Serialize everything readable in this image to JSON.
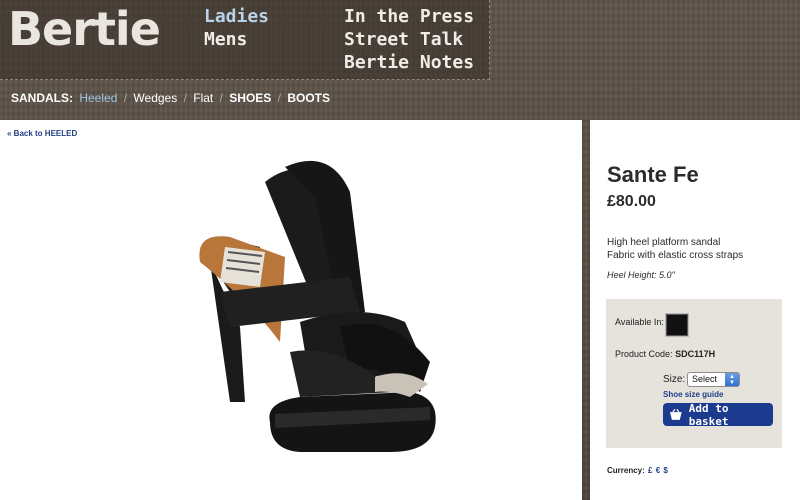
{
  "brand": {
    "logo": "Bertie"
  },
  "nav": {
    "col1": [
      {
        "label": "Ladies",
        "active": true
      },
      {
        "label": "Mens",
        "active": false
      }
    ],
    "col2": [
      {
        "label": "In the Press"
      },
      {
        "label": "Street Talk"
      },
      {
        "label": "Bertie Notes"
      }
    ]
  },
  "subnav": {
    "sandals_label": "SANDALS:",
    "heeled": "Heeled",
    "wedges": "Wedges",
    "flat": "Flat",
    "shoes": "SHOES",
    "boots": "BOOTS",
    "separator": "/"
  },
  "main": {
    "back_link": "« Back to HEELED"
  },
  "product": {
    "name": "Sante Fe",
    "price": "£80.00",
    "description_line1": "High heel platform sandal",
    "description_line2": "Fabric with elastic cross straps",
    "heel_height": "Heel Height: 5.0\"",
    "available_label": "Available In:",
    "swatch_color": "#111111",
    "product_code_label": "Product Code:",
    "product_code": "SDC117H",
    "size_label": "Size:",
    "size_value": "Select",
    "size_guide": "Shoe size guide",
    "add_to_basket": "Add to basket"
  },
  "currency": {
    "label": "Currency:",
    "gbp": "£",
    "eur": "€",
    "usd": "$"
  },
  "colors": {
    "link_blue": "#1f3f86",
    "button_blue": "#1d3b8e",
    "active_nav": "#b8d2ea"
  }
}
